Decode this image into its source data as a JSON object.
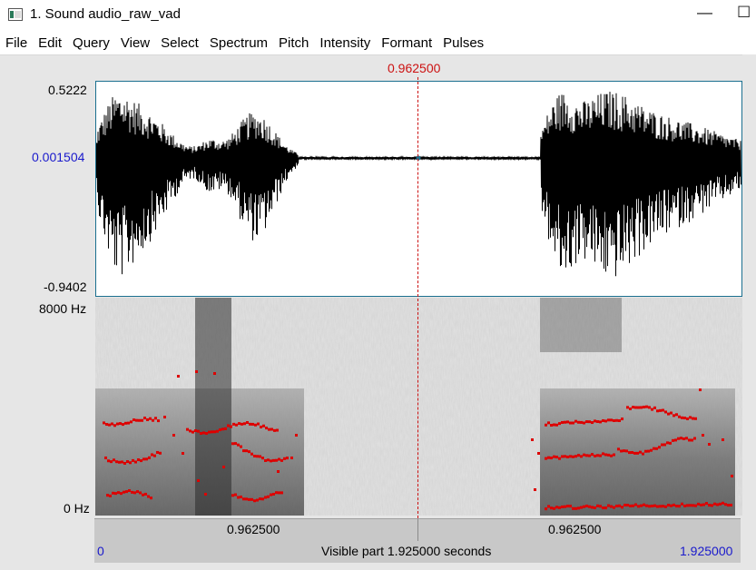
{
  "window": {
    "title": "1. Sound audio_raw_vad",
    "minimize": "—",
    "maximize": "☐"
  },
  "menu": [
    "File",
    "Edit",
    "Query",
    "View",
    "Select",
    "Spectrum",
    "Pitch",
    "Intensity",
    "Formant",
    "Pulses"
  ],
  "cursor": {
    "time": "0.962500"
  },
  "waveform": {
    "y_max": "0.5222",
    "y_mid": "0.001504",
    "y_min": "-0.9402"
  },
  "spectrogram": {
    "f_max": "8000 Hz",
    "f_min": "0 Hz"
  },
  "segments": {
    "left": "0.962500",
    "right": "0.962500"
  },
  "visible": {
    "start": "0",
    "label": "Visible part 1.925000 seconds",
    "end": "1.925000"
  },
  "colors": {
    "cursor": "#cc1111",
    "formant": "#dd0000",
    "axis_blue": "#1a1acc"
  }
}
